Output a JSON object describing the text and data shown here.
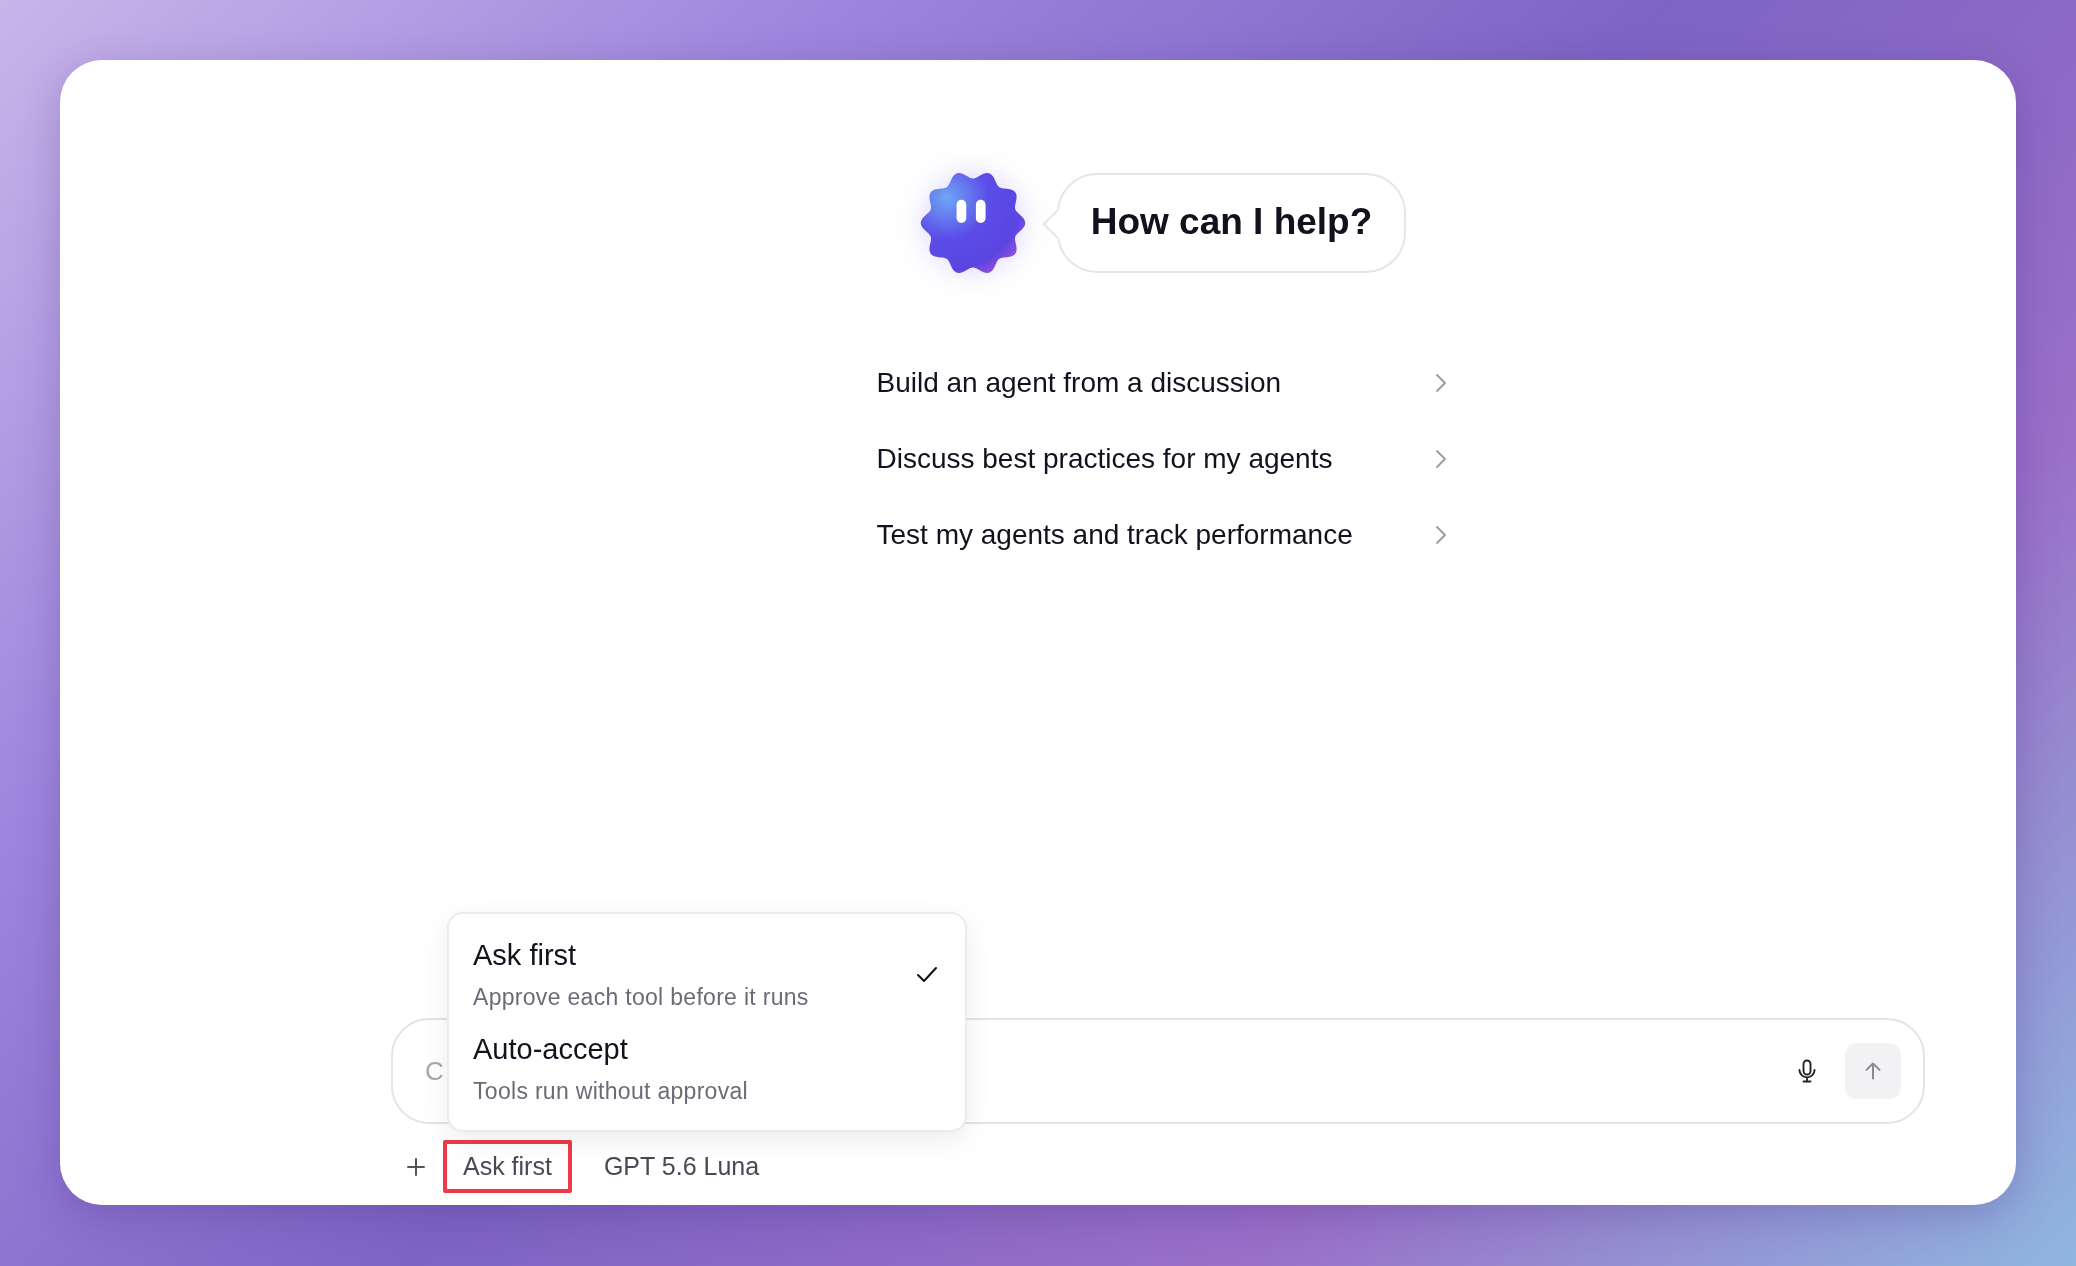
{
  "greeting": {
    "text": "How can I help?"
  },
  "suggestions": [
    {
      "label": "Build an agent from a discussion"
    },
    {
      "label": "Discuss best practices for my agents"
    },
    {
      "label": "Test my agents and track performance"
    }
  ],
  "composer": {
    "placeholder": "C"
  },
  "mode_menu": {
    "options": [
      {
        "title": "Ask first",
        "description": "Approve each tool before it runs",
        "selected": true
      },
      {
        "title": "Auto-accept",
        "description": "Tools run without approval",
        "selected": false
      }
    ]
  },
  "toolbar": {
    "mode": {
      "label": "Ask first",
      "highlighted": true
    },
    "model": {
      "label": "GPT 5.6 Luna"
    }
  }
}
